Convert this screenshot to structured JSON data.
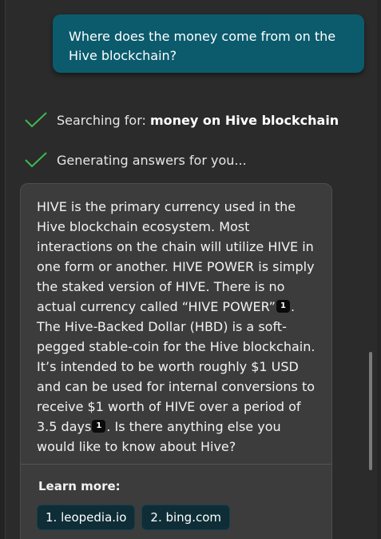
{
  "user_message": {
    "line1": "Where does the money come from on the",
    "line2": "Hive blockchain?"
  },
  "progress": {
    "search_prefix": "Searching for: ",
    "search_query": "money on Hive blockchain",
    "generating": "Generating answers for you..."
  },
  "answer": {
    "part1": "HIVE is the primary currency used in the Hive blockchain ecosystem. Most interactions on the chain will utilize HIVE in one form or another. HIVE POWER is simply the staked version of HIVE. There is no actual currency called “HIVE POWER”",
    "cite1": "1",
    "part2": ". The Hive-Backed Dollar (HBD) is a soft-pegged stable-coin for the Hive blockchain. It’s intended to be worth roughly $1 USD and can be used for internal conversions to receive $1 worth of HIVE over a period of 3.5 days",
    "cite2": "1",
    "part3": ". Is there anything else you would like to know about Hive?"
  },
  "learn_more": {
    "label": "Learn more:",
    "links": [
      {
        "label": "1. leopedia.io"
      },
      {
        "label": "2. bing.com"
      }
    ]
  },
  "icons": {
    "check": "check-icon"
  },
  "colors": {
    "background": "#2b2b2b",
    "user_bubble": "#0b5b6d",
    "answer_card": "#3c3c3c",
    "check_green": "#3fb950",
    "link_chip": "#0e2d37"
  }
}
